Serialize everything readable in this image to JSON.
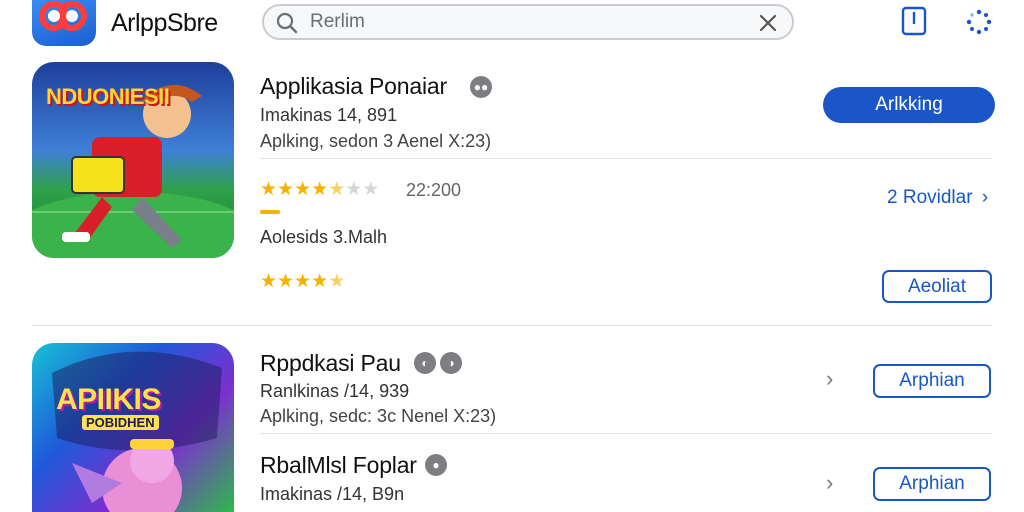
{
  "header": {
    "brand": "ArlppSbre",
    "search_placeholder": "Rerlim",
    "search_value": ""
  },
  "featured": {
    "title": "Applikasia Ponaiar",
    "meta1": "Imakinas 14, 891",
    "meta2": "Aplking, sedon 3 Aenel X:23)",
    "rating_count": "22:200",
    "primary_button": "Arlkking",
    "reviews_link": "2 Rovidlar",
    "info_text": "Aolesids 3.Malh",
    "secondary_button": "Aeoliat",
    "rating_top": 4.5,
    "rating_bottom": 4.5,
    "icon_text": "NDUONIESII"
  },
  "list": [
    {
      "title": "Rppdkasi Pau",
      "meta1": "Ranlkinas /14, 939",
      "meta2": "Aplking, sedc: 3c Nenel X:23)",
      "button": "Arphian",
      "icon_text_top": "APIIKIS",
      "icon_text_sub": "POBIDHEN"
    },
    {
      "title": "RbalMlsl Foplar",
      "meta1": "Imakinas /14, B9n",
      "button": "Arphian"
    }
  ],
  "colors": {
    "accent": "#1a56c8",
    "star": "#f5b301"
  }
}
